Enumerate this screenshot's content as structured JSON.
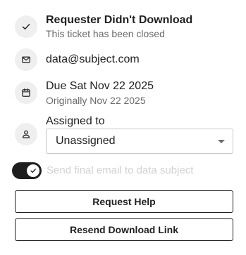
{
  "status": {
    "icon": "check-icon",
    "title": "Requester Didn't Download",
    "subtitle": "This ticket has been closed"
  },
  "email": {
    "icon": "mail-icon",
    "value": "data@subject.com"
  },
  "due": {
    "icon": "calendar-icon",
    "value": "Due Sat Nov 22 2025",
    "original": "Originally Nov 22 2025"
  },
  "assignee": {
    "icon": "user-icon",
    "label": "Assigned to",
    "selected": "Unassigned"
  },
  "final_email_toggle": {
    "on": true,
    "label": "Send final email to data subject"
  },
  "buttons": {
    "request_help": "Request Help",
    "resend_link": "Resend Download Link"
  },
  "colors": {
    "icon_bg": "#efefef",
    "toggle_on": "#1e1e1e",
    "muted_text": "#6b6b6b",
    "disabled_text": "#d2d2d2"
  }
}
